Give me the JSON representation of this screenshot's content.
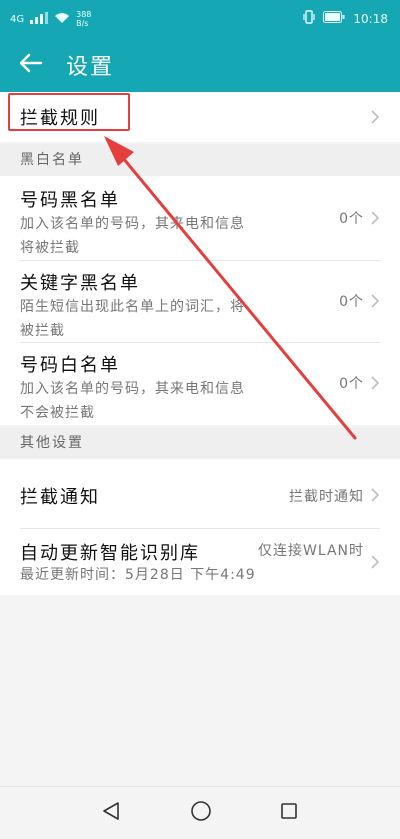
{
  "status_bar": {
    "signal_label": "4G",
    "net_speed_value": "388",
    "net_speed_unit": "B/s",
    "time": "10:18"
  },
  "header": {
    "title": "设置"
  },
  "intercept_rules": {
    "label": "拦截规则"
  },
  "blacklist_section": {
    "title": "黑白名单",
    "items": [
      {
        "label": "号码黑名单",
        "desc": "加入该名单的号码，其来电和信息将被拦截",
        "value": "0个"
      },
      {
        "label": "关键字黑名单",
        "desc": "陌生短信出现此名单上的词汇，将被拦截",
        "value": "0个"
      },
      {
        "label": "号码白名单",
        "desc": "加入该名单的号码，其来电和信息不会被拦截",
        "value": "0个"
      }
    ]
  },
  "other_section": {
    "title": "其他设置",
    "notify": {
      "label": "拦截通知",
      "value": "拦截时通知"
    },
    "auto_update": {
      "label": "自动更新智能识别库",
      "desc": "最近更新时间：5月28日 下午4:49",
      "value": "仅连接WLAN时"
    }
  },
  "colors": {
    "accent": "#15a7b3",
    "highlight": "#e53e3e"
  },
  "icons": {
    "back": "arrow-left-icon",
    "chevron": "chevron-right-icon",
    "nav_back": "triangle-back-icon",
    "nav_home": "circle-home-icon",
    "nav_recent": "square-recent-icon"
  }
}
